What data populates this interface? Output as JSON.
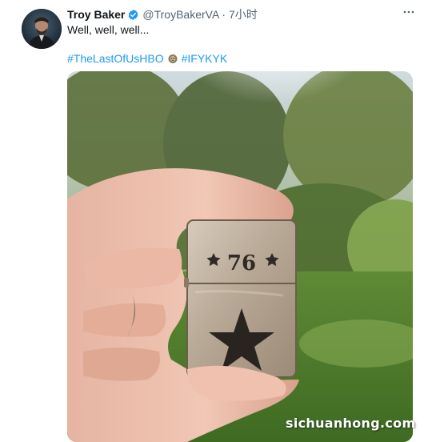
{
  "tweet": {
    "author_name": "Troy Baker",
    "handle_time": "@TroyBakerVA · 7小时",
    "more_icon": "more-horizontal-icon",
    "text": "Well, well, well...",
    "hashtags": [
      "#TheLastOfUsHBO",
      "#IFYKYK"
    ],
    "hashtag_color": "#1d9bf0",
    "verified_color": "#1d9bf0"
  },
  "photo": {
    "lighter_engraving": "76",
    "watermark": "sichuanhong.com"
  }
}
